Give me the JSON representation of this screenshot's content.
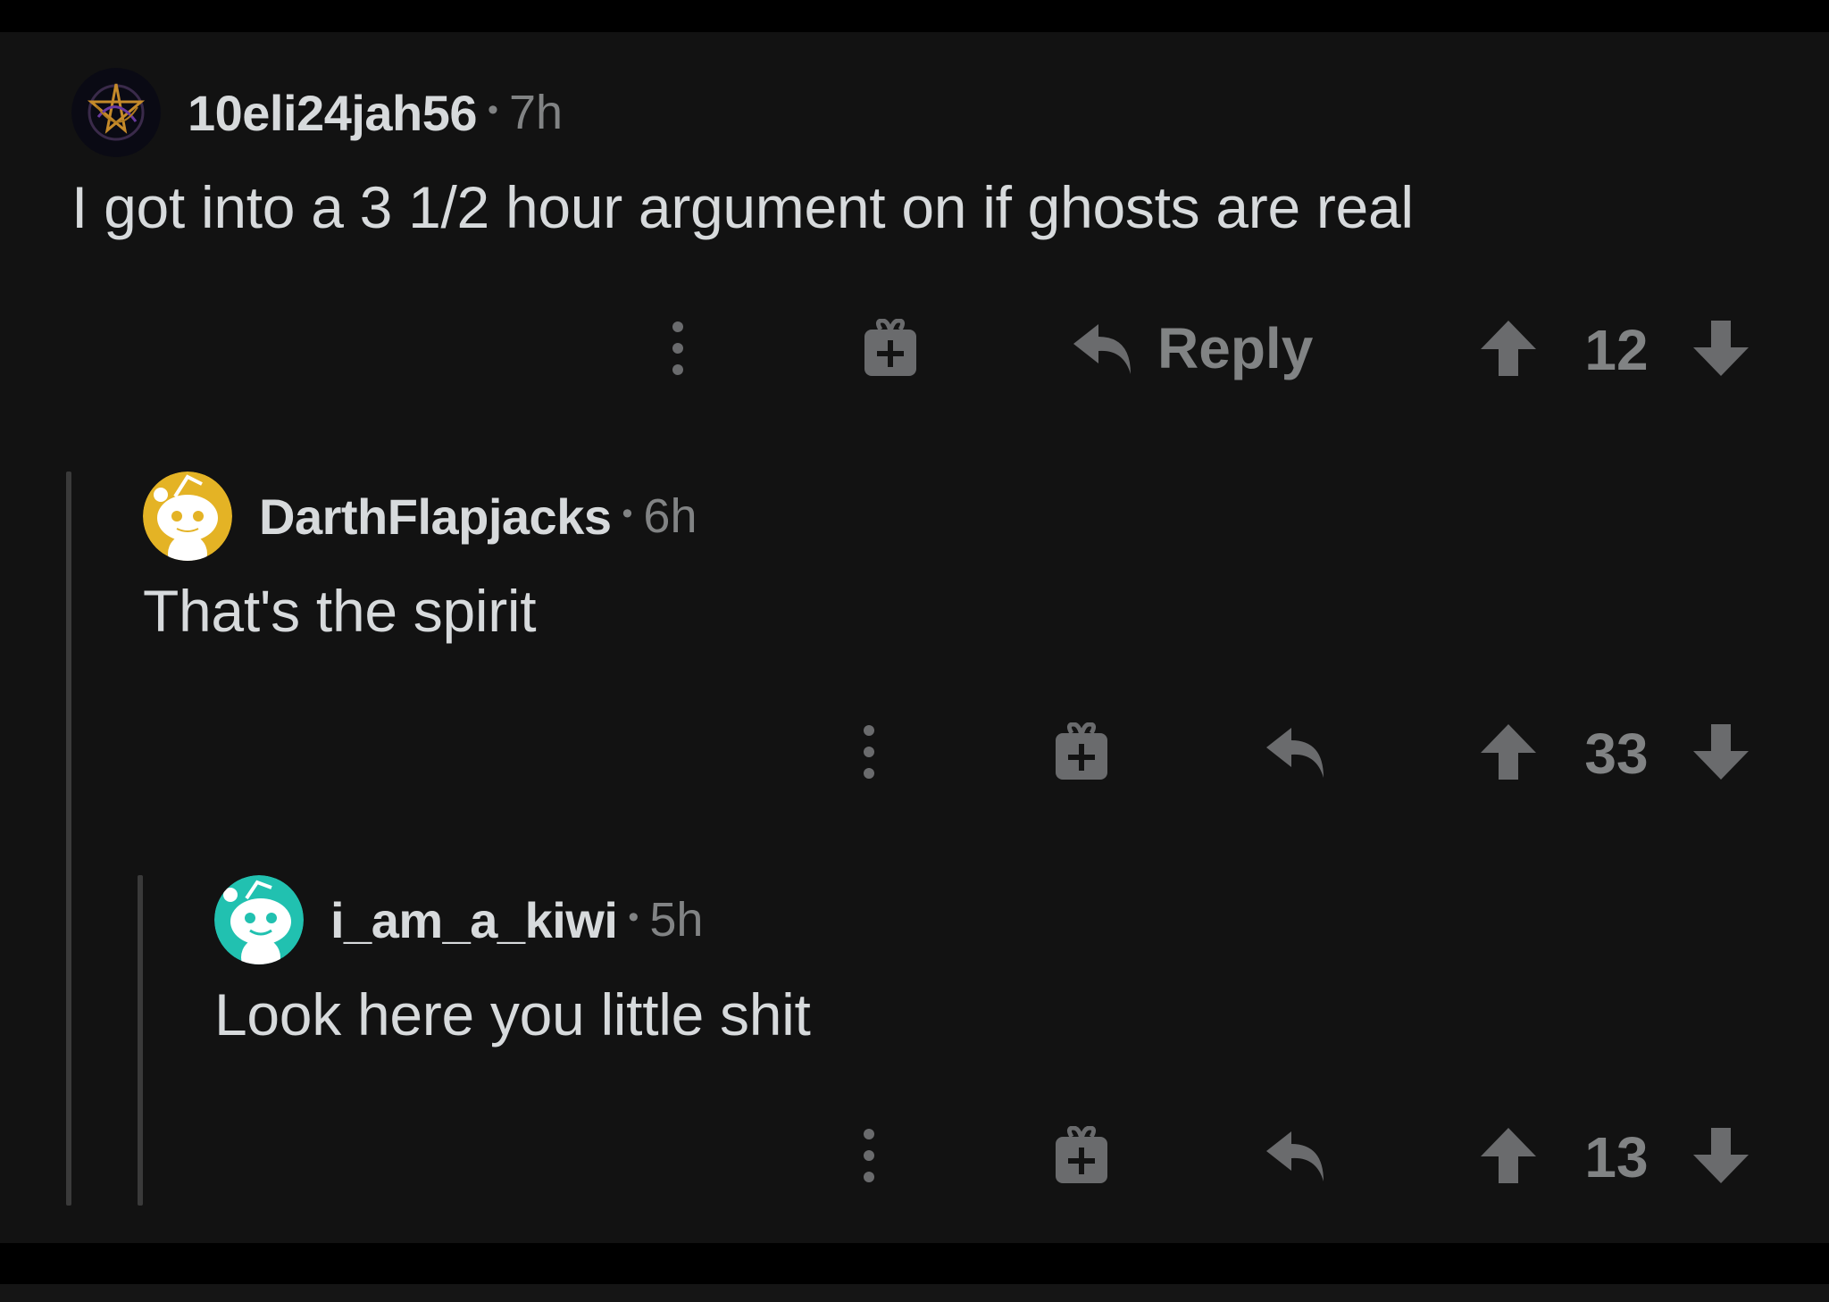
{
  "comments": [
    {
      "username": "10eli24jah56",
      "separator": "•",
      "time": "7h",
      "text": "I got into a 3 1/2 hour argument on if ghosts are real",
      "reply_label": "Reply",
      "score": "12",
      "avatar_icon": "pentagram-avatar"
    },
    {
      "username": "DarthFlapjacks",
      "separator": "•",
      "time": "6h",
      "text": "That's the spirit",
      "score": "33",
      "avatar_icon": "snoo-avatar",
      "avatar_color": "#e4b325"
    },
    {
      "username": "i_am_a_kiwi",
      "separator": "•",
      "time": "5h",
      "text": "Look here you little shit",
      "score": "13",
      "avatar_icon": "snoo-avatar",
      "avatar_color": "#21c1b0"
    }
  ],
  "colors": {
    "background": "#121212",
    "text": "#d7dadc",
    "muted": "#818384",
    "icon": "#6a6b6d"
  }
}
